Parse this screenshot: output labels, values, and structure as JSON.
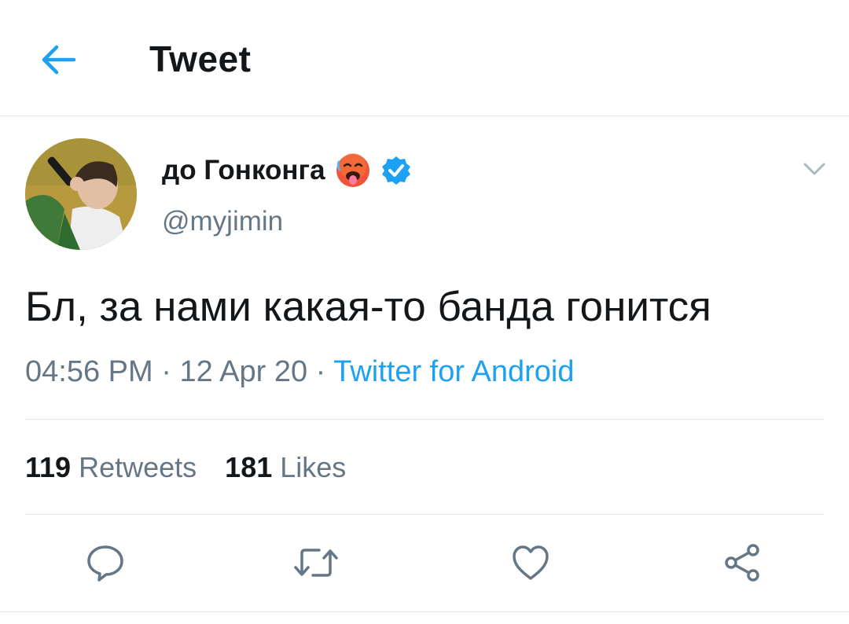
{
  "header": {
    "title": "Tweet",
    "back_icon": "arrow-left-icon"
  },
  "author": {
    "display_name": "до Гонконга",
    "emoji": "hot-face-emoji",
    "verified_icon": "verified-badge-icon",
    "handle": "@myjimin"
  },
  "tweet": {
    "text": "Бл, за нами какая-то банда гонится",
    "time": "04:56 PM",
    "sep1": " · ",
    "date": "12 Apr 20",
    "sep2": " · ",
    "source": "Twitter for Android"
  },
  "stats": {
    "retweets_count": "119",
    "retweets_label": "Retweets",
    "likes_count": "181",
    "likes_label": "Likes"
  },
  "actions": {
    "reply_icon": "reply-icon",
    "retweet_icon": "retweet-icon",
    "like_icon": "heart-icon",
    "share_icon": "share-icon"
  },
  "colors": {
    "accent": "#1da1f2",
    "text": "#14171a",
    "muted": "#657786",
    "divider": "#e1e8ed"
  }
}
